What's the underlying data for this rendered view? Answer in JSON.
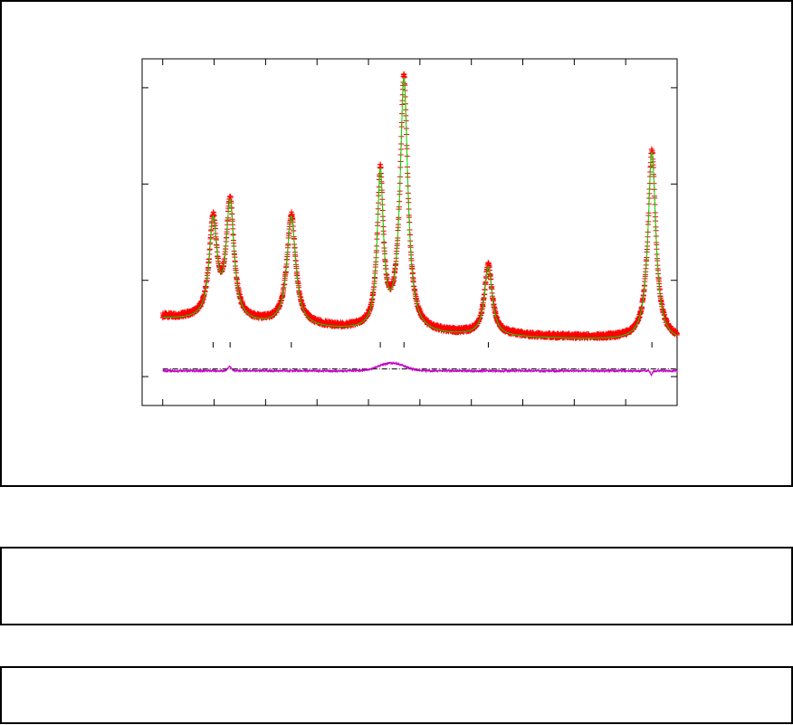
{
  "colors": {
    "observed": "#ff0000",
    "calculated": "#00dd00",
    "difference": "#c000c0",
    "baseline": "#000000",
    "reflection_ticks": "#000000",
    "frame": "#000000"
  },
  "panels": {
    "panel_a_text": "",
    "panel_b_text": ""
  },
  "chart_data": {
    "type": "line",
    "title": "",
    "xlabel": "",
    "ylabel": "",
    "xlim": [
      0,
      10.4
    ],
    "ylim": [
      -0.3,
      3.3
    ],
    "x_ticks": [
      0.4,
      1.4,
      2.4,
      3.4,
      4.4,
      5.4,
      6.4,
      7.4,
      8.4,
      9.4,
      10.4
    ],
    "y_ticks": [
      0,
      1,
      2,
      3
    ],
    "tick_labels_visible": false,
    "grid": false,
    "legend": "none",
    "baseline_level": 0.08,
    "range_start": 0.4,
    "range_end": 10.4,
    "background_level": 0.55,
    "peaks": [
      {
        "center": 1.38,
        "height": 1.6
      },
      {
        "center": 1.71,
        "height": 1.78
      },
      {
        "center": 2.9,
        "height": 1.67
      },
      {
        "center": 4.63,
        "height": 2.08
      },
      {
        "center": 5.09,
        "height": 3.08
      },
      {
        "center": 6.73,
        "height": 1.15
      },
      {
        "center": 9.91,
        "height": 2.35
      }
    ],
    "reflection_positions": [
      1.38,
      1.71,
      2.9,
      4.63,
      5.09,
      6.73,
      9.91
    ],
    "series": [
      {
        "style": "points (+)",
        "color": "#ff0000"
      },
      {
        "style": "line",
        "color": "#00dd00"
      },
      {
        "style": "line",
        "color": "#c000c0"
      }
    ]
  }
}
